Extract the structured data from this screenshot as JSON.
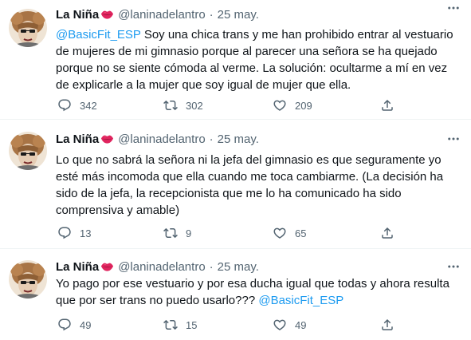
{
  "tweets": [
    {
      "name": "La Niña",
      "handle": "@laninadelantro",
      "separator": "·",
      "time": "25 may.",
      "mention": "@BasicFit_ESP",
      "text": "Soy una chica trans y me han prohibido entrar al vestuario de mujeres de mi gimnasio porque al parecer una señora se ha quejado porque no se siente cómoda al verme. La solución: ocultarme a mí en vez de explicarle a la mujer que soy igual de mujer que ella.",
      "replies": "342",
      "retweets": "302",
      "likes": "209"
    },
    {
      "name": "La Niña",
      "handle": "@laninadelantro",
      "separator": "·",
      "time": "25 may.",
      "text": "Lo que no sabrá la señora ni la jefa del gimnasio es que seguramente yo esté más incomoda que ella cuando me toca cambiarme. (La decisión ha sido de la jefa, la recepcionista que me lo ha comunicado ha sido comprensiva y amable)",
      "replies": "13",
      "retweets": "9",
      "likes": "65"
    },
    {
      "name": "La Niña",
      "handle": "@laninadelantro",
      "separator": "·",
      "time": "25 may.",
      "text": "Yo pago por ese vestuario y por esa ducha igual que todas y ahora resulta que por ser trans no puedo usarlo???",
      "mention": "@BasicFit_ESP",
      "replies": "49",
      "retweets": "15",
      "likes": "49"
    }
  ],
  "colors": {
    "text": "#0f1419",
    "secondary": "#536471",
    "link": "#1d9bf0",
    "lips": "#e0245e"
  },
  "icons": [
    "avatar",
    "lips-icon",
    "more-icon",
    "reply-icon",
    "retweet-icon",
    "like-icon",
    "share-icon"
  ]
}
